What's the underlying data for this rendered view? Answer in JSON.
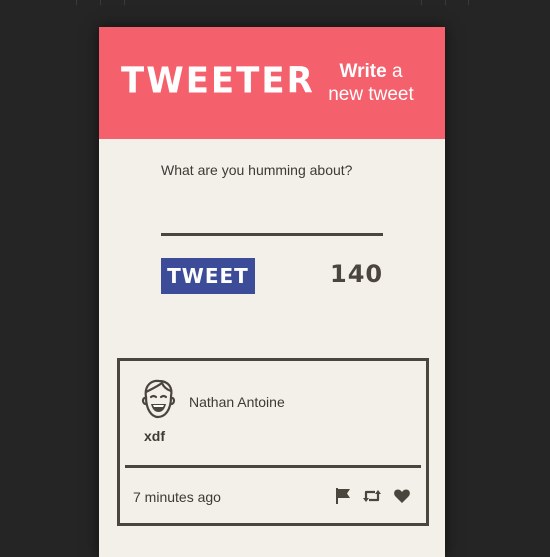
{
  "header": {
    "logo": "TWEETER",
    "subtitle_bold": "Write",
    "subtitle_rest_1": "a",
    "subtitle_rest_2": "new tweet"
  },
  "compose": {
    "prompt": "What are you humming about?",
    "textarea_value": "",
    "tweet_button_label": "TWEET",
    "char_count": "140"
  },
  "tweets": [
    {
      "username": "Nathan Antoine",
      "text": "xdf",
      "timestamp": "7 minutes ago",
      "avatar_icon": "smiling-face-avatar",
      "action_icons": [
        "flag-icon",
        "retweet-icon",
        "heart-icon"
      ]
    }
  ],
  "colors": {
    "background": "#252525",
    "card": "#f3f0ea",
    "header": "#f4606c",
    "button": "#3d4c99",
    "ink": "#4a463e"
  }
}
